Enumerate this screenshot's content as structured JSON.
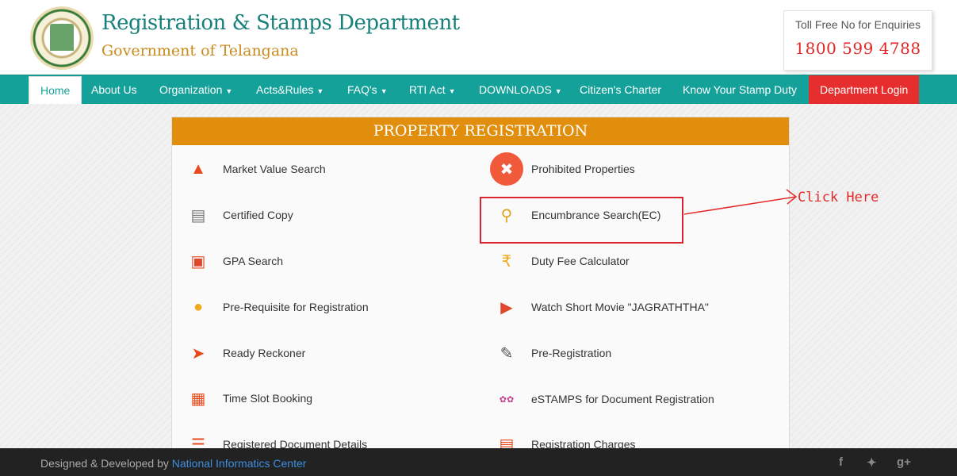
{
  "header": {
    "title": "Registration & Stamps Department",
    "subtitle": "Government of Telangana",
    "tollfree_label": "Toll Free No for Enquiries",
    "tollfree_number": "1800 599 4788"
  },
  "nav": {
    "home": "Home",
    "about": "About Us",
    "organization": "Organization",
    "acts": "Acts&Rules",
    "faq": "FAQ's",
    "rti": "RTI Act",
    "downloads": "DOWNLOADS",
    "charter": "Citizen's Charter",
    "stamp_duty": "Know Your Stamp Duty",
    "dept_login": "Department Login"
  },
  "panel": {
    "title": "PROPERTY REGISTRATION",
    "left": [
      {
        "label": "Market Value Search",
        "icon": "chart-up-icon"
      },
      {
        "label": "Certified Copy",
        "icon": "certificate-icon"
      },
      {
        "label": "GPA Search",
        "icon": "document-search-icon"
      },
      {
        "label": "Pre-Requisite for Registration",
        "icon": "document-seal-icon"
      },
      {
        "label": "Ready Reckoner",
        "icon": "signpost-icon"
      },
      {
        "label": "Time Slot Booking",
        "icon": "calendar-clock-icon"
      },
      {
        "label": "Registered Document Details",
        "icon": "document-list-icon"
      }
    ],
    "right": [
      {
        "label": "Prohibited Properties",
        "icon": "prohibited-icon"
      },
      {
        "label": "Encumbrance Search(EC)",
        "icon": "magnifier-document-icon"
      },
      {
        "label": "Duty Fee Calculator",
        "icon": "rupee-hand-icon"
      },
      {
        "label": "Watch Short Movie \"JAGRATHTHA\"",
        "icon": "movie-box-icon"
      },
      {
        "label": "Pre-Registration",
        "icon": "form-pen-icon"
      },
      {
        "label": "eSTAMPS for Document Registration",
        "icon": "estamps-logo-icon"
      },
      {
        "label": "Registration Charges",
        "icon": "charges-document-icon"
      }
    ]
  },
  "annotation": {
    "click_here": "Click Here"
  },
  "footer": {
    "prefix": "Designed & Developed by",
    "link": "National Informatics Center"
  }
}
